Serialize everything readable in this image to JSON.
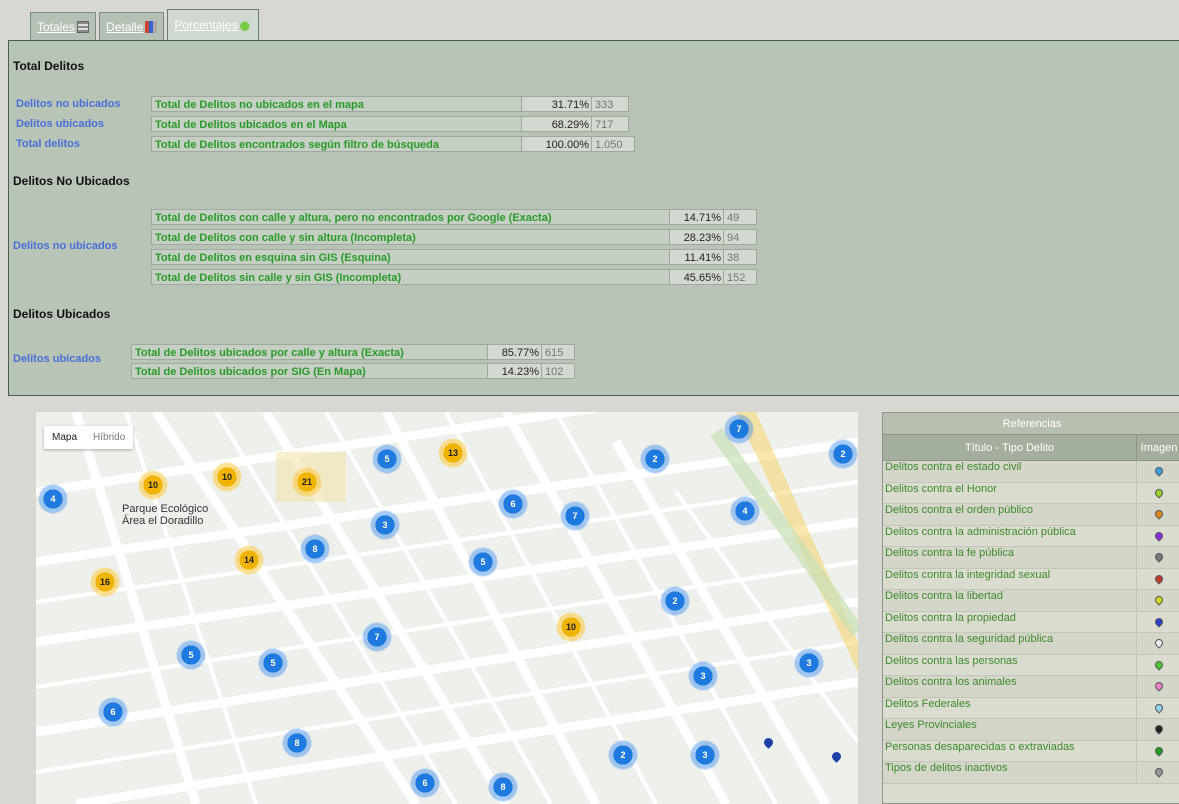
{
  "tabs": [
    {
      "label": "Totales",
      "icon": "grid-icon"
    },
    {
      "label": "Detalle",
      "icon": "bar-chart-icon"
    },
    {
      "label": "Porcentajes",
      "icon": "leaf-icon"
    }
  ],
  "totales": {
    "title": "Total Delitos",
    "rows": [
      {
        "link": "Delitos no ubicados",
        "desc": "Total de Delitos no ubicados en el mapa",
        "pct": "31.71%",
        "num": "333"
      },
      {
        "link": "Delitos ubicados",
        "desc": "Total de Delitos ubicados en el Mapa",
        "pct": "68.29%",
        "num": "717"
      },
      {
        "link": "Total delitos",
        "desc": "Total de Delitos encontrados según filtro de búsqueda",
        "pct": "100.00%",
        "num": "1.050"
      }
    ]
  },
  "no_ubicados": {
    "title": "Delitos No Ubicados",
    "group_label": "Delitos no ubicados",
    "rows": [
      {
        "desc": "Total de Delitos con calle y altura, pero no encontrados por Google (Exacta)",
        "pct": "14.71%",
        "num": "49"
      },
      {
        "desc": "Total de Delitos con calle y sin altura (Incompleta)",
        "pct": "28.23%",
        "num": "94"
      },
      {
        "desc": "Total de Delitos en esquina sin GIS (Esquina)",
        "pct": "11.41%",
        "num": "38"
      },
      {
        "desc": "Total de Delitos sin calle y sin GIS (Incompleta)",
        "pct": "45.65%",
        "num": "152"
      }
    ]
  },
  "ubicados": {
    "title": "Delitos Ubicados",
    "group_label": "Delitos ubicados",
    "rows": [
      {
        "desc": "Total de Delitos ubicados por calle y altura (Exacta)",
        "pct": "85.77%",
        "num": "615"
      },
      {
        "desc": "Total de Delitos ubicados por SIG (En Mapa)",
        "pct": "14.23%",
        "num": "102"
      }
    ]
  },
  "map": {
    "type_buttons": [
      "Mapa",
      "Híbrido"
    ],
    "park_label_1": "Parque Ecológico",
    "park_label_2": "Área el Doradillo",
    "clusters": [
      {
        "n": "4",
        "color": "blue"
      },
      {
        "n": "10",
        "color": "yellow"
      },
      {
        "n": "10",
        "color": "yellow"
      },
      {
        "n": "21",
        "color": "yellow"
      },
      {
        "n": "5",
        "color": "blue"
      },
      {
        "n": "13",
        "color": "yellow"
      },
      {
        "n": "2",
        "color": "blue"
      },
      {
        "n": "7",
        "color": "blue"
      },
      {
        "n": "2",
        "color": "blue"
      },
      {
        "n": "6",
        "color": "blue"
      },
      {
        "n": "7",
        "color": "blue"
      },
      {
        "n": "4",
        "color": "blue"
      },
      {
        "n": "3",
        "color": "blue"
      },
      {
        "n": "14",
        "color": "yellow"
      },
      {
        "n": "8",
        "color": "blue"
      },
      {
        "n": "5",
        "color": "blue"
      },
      {
        "n": "16",
        "color": "yellow"
      },
      {
        "n": "10",
        "color": "yellow"
      },
      {
        "n": "2",
        "color": "blue"
      },
      {
        "n": "5",
        "color": "blue"
      },
      {
        "n": "5",
        "color": "blue"
      },
      {
        "n": "7",
        "color": "blue"
      },
      {
        "n": "3",
        "color": "blue"
      },
      {
        "n": "3",
        "color": "blue"
      },
      {
        "n": "6",
        "color": "blue"
      },
      {
        "n": "8",
        "color": "blue"
      },
      {
        "n": "2",
        "color": "blue"
      },
      {
        "n": "3",
        "color": "blue"
      },
      {
        "n": "6",
        "color": "blue"
      },
      {
        "n": "8",
        "color": "blue"
      }
    ]
  },
  "referencias": {
    "title": "Referencias",
    "col_title": "Título - Tipo Delito",
    "col_image": "Imagen",
    "items": [
      {
        "label": "Delitos contra el estado civil",
        "color": "#3aa0e0"
      },
      {
        "label": "Delitos contra el Honor",
        "color": "#9ad12a"
      },
      {
        "label": "Delitos contra el orden público",
        "color": "#e08a1e"
      },
      {
        "label": "Delitos contra la administración pública",
        "color": "#8a2be2"
      },
      {
        "label": "Delitos contra la fe pública",
        "color": "#777777"
      },
      {
        "label": "Delitos contra la integridad sexual",
        "color": "#c0392b"
      },
      {
        "label": "Delitos contra la libertad",
        "color": "#d4d41a"
      },
      {
        "label": "Delitos contra la propiedad",
        "color": "#2c3fc8"
      },
      {
        "label": "Delitos contra la seguridad pública",
        "color": "#e8e8e8"
      },
      {
        "label": "Delitos contra las personas",
        "color": "#4cc832"
      },
      {
        "label": "Delitos contra los animales",
        "color": "#ee82c8"
      },
      {
        "label": "Delitos Federales",
        "color": "#8fd4f0"
      },
      {
        "label": "Leyes Provinciales",
        "color": "#222222"
      },
      {
        "label": "Personas desaparecidas o extraviadas",
        "color": "#1ea01e"
      },
      {
        "label": "Tipos de delitos inactivos",
        "color": "#999999"
      }
    ]
  }
}
